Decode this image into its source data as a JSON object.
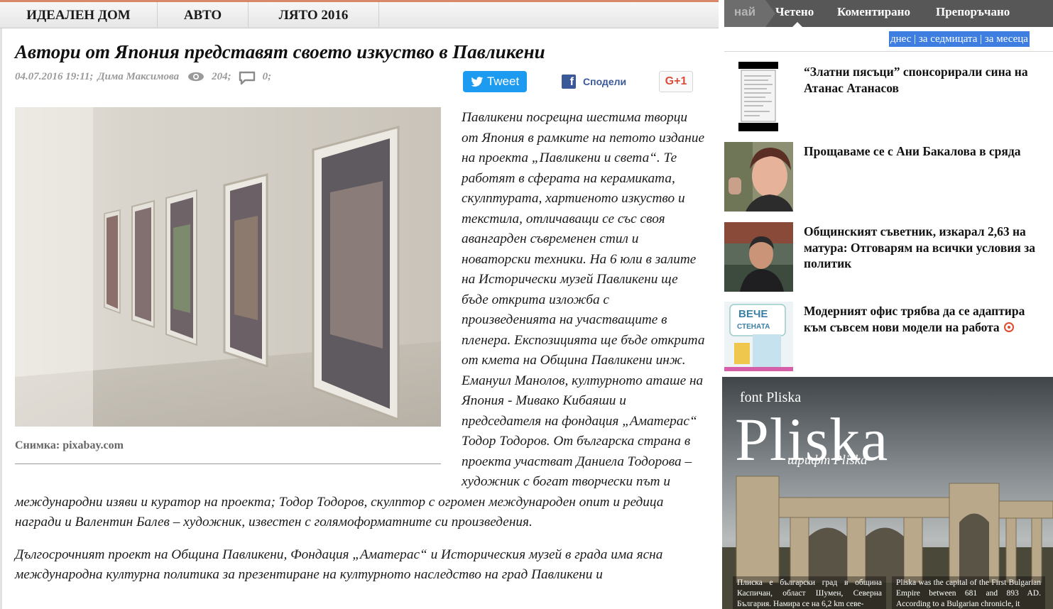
{
  "topnav": {
    "items": [
      {
        "label": "ИДЕАЛЕН ДОМ"
      },
      {
        "label": "АВТО"
      },
      {
        "label": "ЛЯТО 2016"
      }
    ]
  },
  "article": {
    "title": "Автори от Япония представят своето изкуство в Павликени",
    "datetime": "04.07.2016 19:11;",
    "author": "Дима Максимова",
    "views": "204;",
    "comments": "0;",
    "caption": "Снимка: pixabay.com",
    "paragraphs": [
      "Павликени посрещна шестима творци от Япония в рамките на петото издание на проекта „Павликени и света“. Те работят в сферата на керамиката, скулптурата, хартиеното изкуство и текстила, отличаващи се със своя авангарден съвременен стил и новаторски техники. На 6 юли в залите на Исторически музей Павликени ще бъде открита изложба с произведенията на участващите в пленера. Експозицията ще бъде открита от кмета на Община Павликени инж. Емануил Манолов, културното аташе на Япония - Мивако Кибаяши и председателя на фондация „Аматерас“ Тодор Тодоров. От българска страна в проекта участват Даниела Тодорова – художник с богат творчески път и международни изяви и куратор на проекта; Тодор Тодоров, скулптор с огромен международен опит и редица награди и Валентин Балев – художник, известен с голямоформатните си произведения.",
      "Дългосрочният проект на Община Павликени, Фондация „Аматерас“ и Историческия музей в града има ясна международна културна политика за презентиране на културното наследство на град Павликени и"
    ]
  },
  "social": {
    "tweet_label": "Tweet",
    "share_label": "Сподели",
    "gplus_label": "G+1"
  },
  "sidebar": {
    "tab_prefix": "най",
    "tabs": [
      {
        "label": "Четено"
      },
      {
        "label": "Коментирано"
      },
      {
        "label": "Препоръчано"
      }
    ],
    "periods": [
      "днес",
      "за седмицата",
      "за месеца"
    ],
    "news": [
      {
        "title": "“Златни пясъци” спонсорирали сина на Атанас Атанасов"
      },
      {
        "title": "Прощаваме се с Ани Бакалова в сряда"
      },
      {
        "title": "Общинският съветник, изкарал 2,63 на матура: Отговарям на всички условия за политик"
      },
      {
        "title": "Модерният офис трябва да се адаптира към съвсем нови модели на работа"
      }
    ],
    "thumb4_text": [
      "ВЕЧЕ",
      "СТЕНАТА"
    ]
  },
  "ad": {
    "font_label": "font Pliska",
    "big_title": "Pliska",
    "sub_title": "шрифт Pliska",
    "text_bg": "Плиска е български град в община Каспичан, област Шумен, Северна България. Намира се на 6,2 km севе-",
    "text_en": "Pliska was the capital of the First Bulgarian Empire between 681 and 893 AD. According to a Bulgarian chronicle, it"
  },
  "colors": {
    "accent_top": "#d9886a",
    "tweet": "#1d9bf0",
    "facebook": "#3b5998",
    "gplus": "#dd4b39",
    "tabs_bg": "#575757",
    "period_highlight": "#3d7ee0"
  }
}
